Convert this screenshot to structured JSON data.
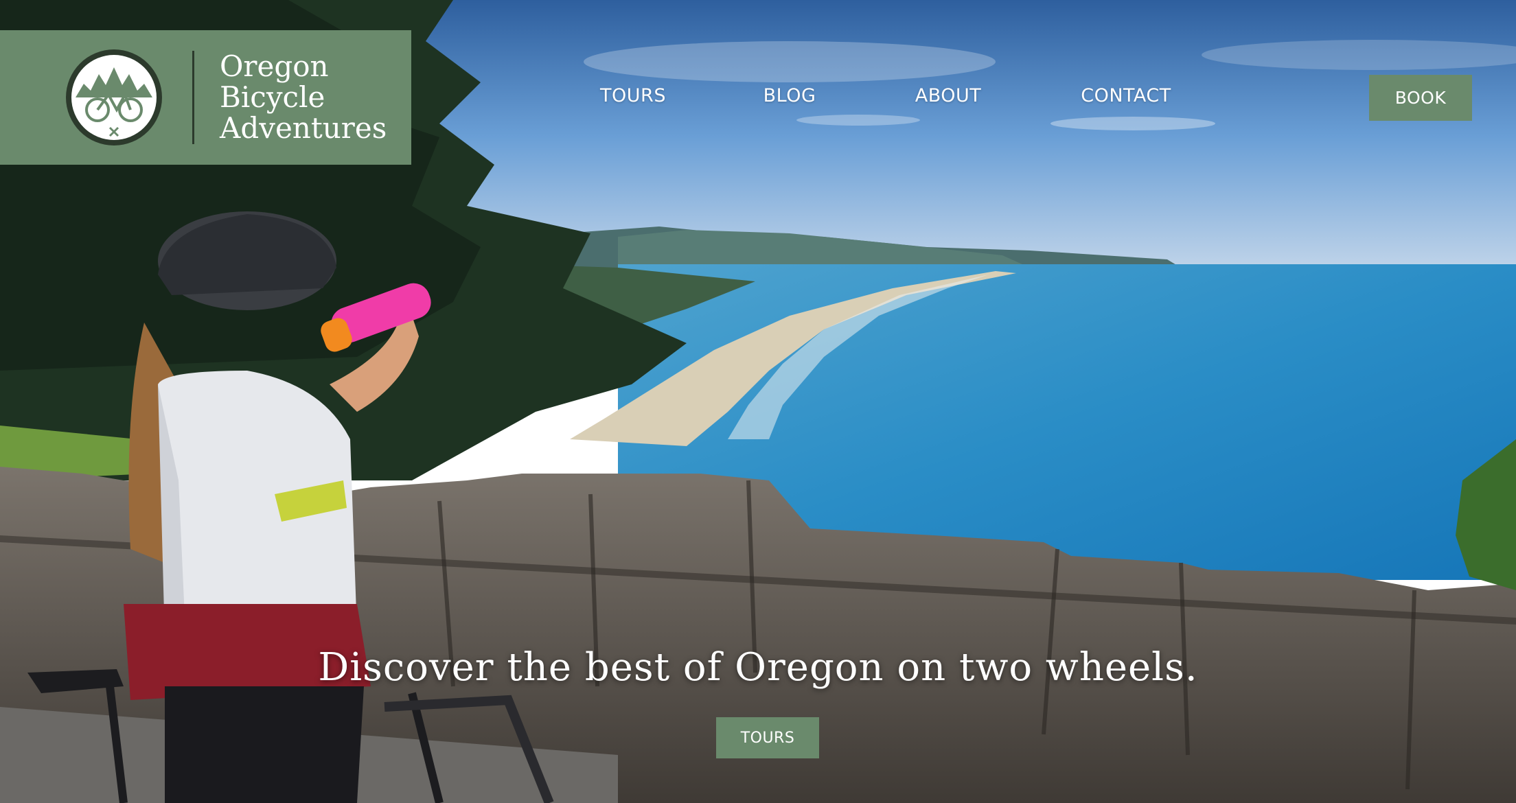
{
  "brand": {
    "line1": "Oregon",
    "line2": "Bicycle",
    "line3": "Adventures",
    "color": "#6a8a6c"
  },
  "nav": {
    "items": [
      {
        "label": "TOURS"
      },
      {
        "label": "BLOG"
      },
      {
        "label": "ABOUT"
      },
      {
        "label": "CONTACT"
      }
    ],
    "book_label": "BOOK"
  },
  "hero": {
    "headline": "Discover the best of Oregon on two wheels.",
    "cta_label": "TOURS"
  }
}
